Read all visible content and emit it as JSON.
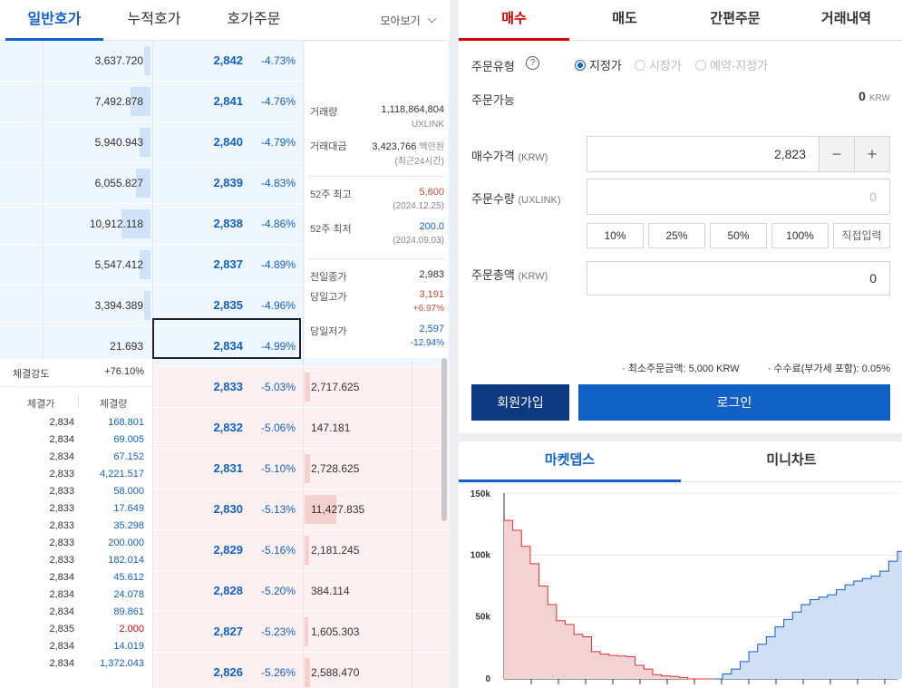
{
  "left_tabs": {
    "general": "일반호가",
    "cumulative": "누적호가",
    "order": "호가주문",
    "view_all": "모아보기"
  },
  "asks": [
    {
      "volume": "3,637.720",
      "price": "2,842",
      "pct": "-4.73%",
      "fill": 0.06
    },
    {
      "volume": "7,492.878",
      "price": "2,841",
      "pct": "-4.76%",
      "fill": 0.18
    },
    {
      "volume": "5,940.943",
      "price": "2,840",
      "pct": "-4.79%",
      "fill": 0.1
    },
    {
      "volume": "6,055.827",
      "price": "2,839",
      "pct": "-4.83%",
      "fill": 0.13
    },
    {
      "volume": "10,912.118",
      "price": "2,838",
      "pct": "-4.86%",
      "fill": 0.27
    },
    {
      "volume": "5,547.412",
      "price": "2,837",
      "pct": "-4.89%",
      "fill": 0.1
    },
    {
      "volume": "3,394.389",
      "price": "2,835",
      "pct": "-4.96%",
      "fill": 0.06
    },
    {
      "volume": "21.693",
      "price": "2,834",
      "pct": "-4.99%",
      "fill": 0.0
    }
  ],
  "bids": [
    {
      "volume": "2,717.625",
      "price": "2,833",
      "pct": "-5.03%",
      "fill": 0.05
    },
    {
      "volume": "147.181",
      "price": "2,832",
      "pct": "-5.06%",
      "fill": 0.0
    },
    {
      "volume": "2,728.625",
      "price": "2,831",
      "pct": "-5.10%",
      "fill": 0.05
    },
    {
      "volume": "11,427.835",
      "price": "2,830",
      "pct": "-5.13%",
      "fill": 0.29
    },
    {
      "volume": "2,181.245",
      "price": "2,829",
      "pct": "-5.16%",
      "fill": 0.04
    },
    {
      "volume": "384.114",
      "price": "2,828",
      "pct": "-5.20%",
      "fill": 0.0
    },
    {
      "volume": "1,605.303",
      "price": "2,827",
      "pct": "-5.23%",
      "fill": 0.03
    },
    {
      "volume": "2,588.470",
      "price": "2,826",
      "pct": "-5.26%",
      "fill": 0.05
    }
  ],
  "info": {
    "volume_label": "거래량",
    "volume_value": "1,118,864,804",
    "volume_unit": "UXLINK",
    "amount_label": "거래대금",
    "amount_value": "3,423,766",
    "amount_unit": "백만원",
    "amount_note": "(최근24시간)",
    "high52_label": "52주 최고",
    "high52_value": "5,600",
    "high52_date": "(2024.12.25)",
    "low52_label": "52주 최저",
    "low52_value": "200.0",
    "low52_date": "(2024.09.03)",
    "prev_label": "전일종가",
    "prev_value": "2,983",
    "dayhigh_label": "당일고가",
    "dayhigh_value": "3,191",
    "dayhigh_pct": "+6.97%",
    "daylow_label": "당일저가",
    "daylow_value": "2,597",
    "daylow_pct": "-12.94%"
  },
  "strength": {
    "label": "체결강도",
    "value": "+76.10%"
  },
  "trades_header": {
    "price": "체결가",
    "volume": "체결량"
  },
  "trades": [
    {
      "price": "2,834",
      "volume": "168.801",
      "side": "buy"
    },
    {
      "price": "2,834",
      "volume": "69.005",
      "side": "buy"
    },
    {
      "price": "2,834",
      "volume": "67.152",
      "side": "buy"
    },
    {
      "price": "2,833",
      "volume": "4,221.517",
      "side": "buy"
    },
    {
      "price": "2,833",
      "volume": "58.000",
      "side": "buy"
    },
    {
      "price": "2,833",
      "volume": "17.649",
      "side": "buy"
    },
    {
      "price": "2,833",
      "volume": "35.298",
      "side": "buy"
    },
    {
      "price": "2,833",
      "volume": "200.000",
      "side": "buy"
    },
    {
      "price": "2,833",
      "volume": "182.014",
      "side": "buy"
    },
    {
      "price": "2,834",
      "volume": "45.612",
      "side": "buy"
    },
    {
      "price": "2,834",
      "volume": "24.078",
      "side": "buy"
    },
    {
      "price": "2,834",
      "volume": "89.861",
      "side": "buy"
    },
    {
      "price": "2,835",
      "volume": "2.000",
      "side": "sell"
    },
    {
      "price": "2,834",
      "volume": "14.019",
      "side": "buy"
    },
    {
      "price": "2,834",
      "volume": "1,372.043",
      "side": "buy"
    }
  ],
  "right_tabs": {
    "buy": "매수",
    "sell": "매도",
    "simple": "간편주문",
    "history": "거래내역"
  },
  "order": {
    "type_label": "주문유형",
    "help_icon": "?",
    "type_limit": "지정가",
    "type_market": "시장가",
    "type_reserve": "예약-지정가",
    "available_label": "주문가능",
    "available_value": "0",
    "available_unit": "KRW",
    "price_label": "매수가격",
    "price_unit": "(KRW)",
    "price_value": "2,823",
    "minus": "−",
    "plus": "+",
    "qty_label": "주문수량",
    "qty_unit": "(UXLINK)",
    "qty_value": "0",
    "pct_buttons": [
      "10%",
      "25%",
      "50%",
      "100%",
      "직접입력"
    ],
    "total_label": "주문총액",
    "total_unit": "(KRW)",
    "total_value": "0",
    "min_order": "최소주문금액: 5,000 KRW",
    "fee": "수수료(부가세 포함): 0.05%",
    "join": "회원가입",
    "login": "로그인"
  },
  "depth_tabs": {
    "market_depth": "마켓뎁스",
    "mini_chart": "미니차트"
  },
  "chart_data": {
    "type": "area",
    "y_ticks": [
      "150k",
      "100k",
      "50k",
      "0"
    ],
    "ylim": [
      0,
      150000
    ],
    "series": [
      {
        "side": "bid",
        "color": "#f2d2d2",
        "line": "#d33",
        "x": [
          0,
          1,
          2,
          3,
          4,
          5,
          6,
          7,
          8,
          9,
          10,
          11,
          12,
          13,
          14,
          15,
          16,
          17,
          18,
          19,
          20,
          21,
          22,
          23
        ],
        "y": [
          128000,
          120000,
          107000,
          93000,
          75000,
          60000,
          47000,
          44000,
          36000,
          34000,
          22000,
          20000,
          19000,
          18500,
          18000,
          11000,
          8000,
          3500,
          2500,
          2000,
          1200,
          0,
          0,
          0
        ]
      },
      {
        "side": "ask",
        "color": "#cfe0f6",
        "line": "#1261c4",
        "x": [
          24,
          25,
          26,
          27,
          28,
          29,
          30,
          31,
          32,
          33,
          34,
          35,
          36,
          37,
          38,
          39,
          40,
          41,
          42,
          43,
          44,
          45
        ],
        "y": [
          0,
          4000,
          8000,
          14000,
          22000,
          28000,
          34000,
          42000,
          48000,
          54000,
          60000,
          64000,
          66000,
          68000,
          72000,
          76000,
          79000,
          81000,
          83000,
          87000,
          95000,
          103000
        ]
      }
    ]
  }
}
